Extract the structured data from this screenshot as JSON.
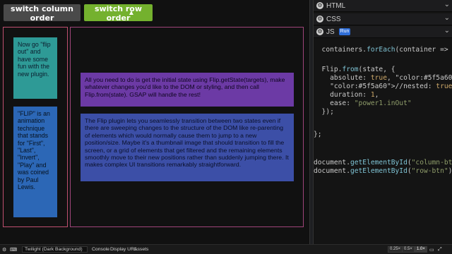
{
  "preview": {
    "buttons": {
      "switch_column": "switch column order",
      "switch_row": "switch row order"
    },
    "left_boxes": [
      "Now go \"flip out\" and have some fun with the new plugin.",
      "\"FLIP\" is an animation technique that stands for \"First\", \"Last\", \"Invert\", \"Play\" and was coined by Paul Lewis."
    ],
    "right_boxes": [
      "All you need to do is get the initial state using Flip.getState(targets), make whatever changes you'd like to the DOM or styling, and then call Flip.from(state). GSAP will handle the rest!",
      "The Flip plugin lets you seamlessly transition between two states even if there are sweeping changes to the structure of the DOM like re-parenting of elements which would normally cause them to jump to a new position/size. Maybe it's a thumbnail image that should transition to fill the screen, or a grid of elements that get filtered and the remaining elements smoothly move to their new positions rather than suddenly jumping there. It makes complex UI transitions remarkably straightforward."
    ]
  },
  "editor": {
    "panels": {
      "html": "HTML",
      "css": "CSS",
      "js": "JS"
    },
    "run_label": "Run",
    "code_lines": [
      {
        "text": "  containers.forEach(container => co"
      },
      {
        "text": ""
      },
      {
        "text": "  Flip.from(state, {"
      },
      {
        "text": "    absolute: true, // flips to pos"
      },
      {
        "text": "    //nested: true,"
      },
      {
        "text": "    duration: 1,"
      },
      {
        "text": "    ease: \"power1.inOut\""
      },
      {
        "text": "  });"
      },
      {
        "text": ""
      },
      {
        "text": "};"
      },
      {
        "text": ""
      },
      {
        "text": ""
      },
      {
        "text": "document.getElementById(\"column-btn"
      },
      {
        "text": "document.getElementById(\"row-btn\")."
      }
    ],
    "colors": {
      "property": "#7fc3d4",
      "number": "#cda869",
      "string": "#8f9d6a",
      "comment": "#5f5a60",
      "keyword": "#cda869",
      "plain": "#cacaca"
    }
  },
  "footer": {
    "theme": "Twilight (Dark Background)",
    "console": "Console",
    "display_url": "Display URL",
    "assets": "Assets",
    "zoom_levels": [
      "0.25×",
      "0.5×",
      "1.0×"
    ],
    "active_zoom": "1.0×"
  }
}
